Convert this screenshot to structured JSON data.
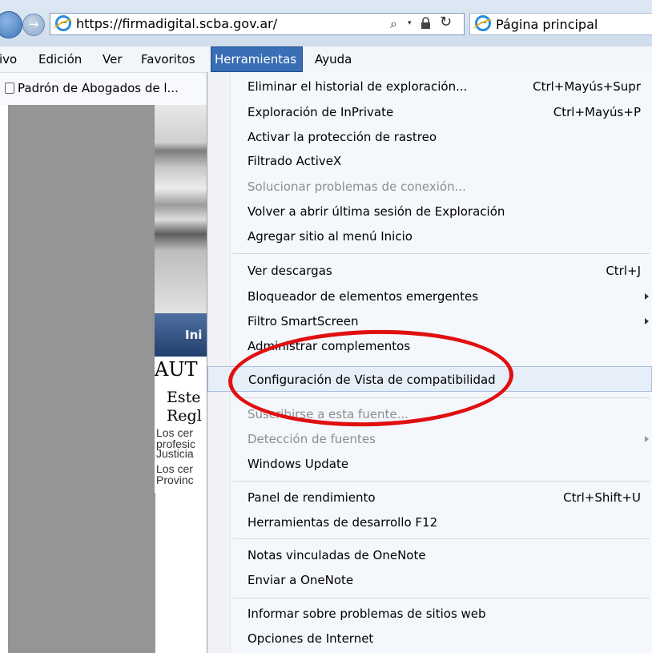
{
  "browser": {
    "url_prefix": "https://",
    "url_domain": "firmadigital.scba.gov.ar",
    "url_suffix": "/",
    "search_glyph": "⌕",
    "dropdown_glyph": "▾",
    "refresh_glyph": "↻",
    "forward_glyph": "→",
    "tab_title": "Página principal"
  },
  "menubar": {
    "items": [
      "ivo",
      "Edición",
      "Ver",
      "Favoritos",
      "Herramientas",
      "Ayuda"
    ],
    "active": "Herramientas"
  },
  "favorites": {
    "item": "Padrón de Abogados de l..."
  },
  "page": {
    "nav_label": "Ini",
    "heading": "AUT",
    "line1": "Este",
    "line2": "Regl",
    "small1": "Los cer",
    "small2": "profesic",
    "small3": "Justicia",
    "small4": "Los cer",
    "small5": "Provinc"
  },
  "tools_menu": {
    "items": [
      {
        "label": "Eliminar el historial de exploración...",
        "shortcut": "Ctrl+Mayús+Supr"
      },
      {
        "label": "Exploración de InPrivate",
        "shortcut": "Ctrl+Mayús+P"
      },
      {
        "label": "Activar la protección de rastreo",
        "shortcut": ""
      },
      {
        "label": "Filtrado ActiveX",
        "shortcut": ""
      },
      {
        "label": "Solucionar problemas de conexión...",
        "shortcut": "",
        "disabled": true
      },
      {
        "label": "Volver a abrir última sesión de Exploración",
        "shortcut": ""
      },
      {
        "label": "Agregar sitio al menú Inicio",
        "shortcut": ""
      },
      {
        "label": "Ver descargas",
        "shortcut": "Ctrl+J"
      },
      {
        "label": "Bloqueador de elementos emergentes",
        "shortcut": "",
        "submenu": true
      },
      {
        "label": "Filtro SmartScreen",
        "shortcut": "",
        "submenu": true
      },
      {
        "label": "Administrar complementos",
        "shortcut": ""
      },
      {
        "label": "Configuración de Vista de compatibilidad",
        "shortcut": "",
        "highlighted": true
      },
      {
        "label": "Suscribirse a esta fuente...",
        "shortcut": "",
        "disabled": true
      },
      {
        "label": "Detección de fuentes",
        "shortcut": "",
        "disabled": true,
        "submenu": true
      },
      {
        "label": "Windows Update",
        "shortcut": ""
      },
      {
        "label": "Panel de rendimiento",
        "shortcut": "Ctrl+Shift+U"
      },
      {
        "label": "Herramientas de desarrollo F12",
        "shortcut": ""
      },
      {
        "label": "Notas vinculadas de OneNote",
        "shortcut": ""
      },
      {
        "label": "Enviar a OneNote",
        "shortcut": ""
      },
      {
        "label": "Informar sobre problemas de sitios web",
        "shortcut": ""
      },
      {
        "label": "Opciones de Internet",
        "shortcut": ""
      }
    ]
  },
  "annotation": {
    "color": "#e01010"
  }
}
